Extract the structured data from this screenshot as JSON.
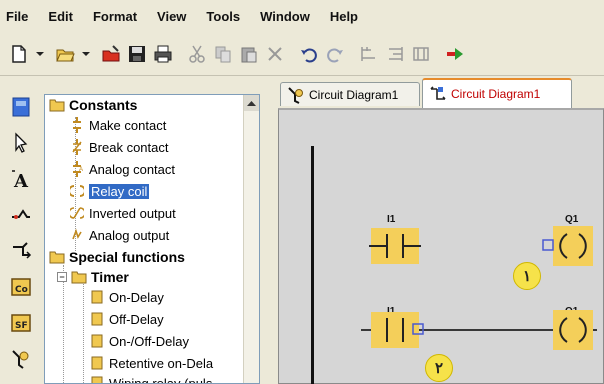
{
  "menu": [
    "File",
    "Edit",
    "Format",
    "View",
    "Tools",
    "Window",
    "Help"
  ],
  "toolbar": {
    "buttons": [
      "new-icon",
      "open-icon",
      "open-recent-icon",
      "save-icon",
      "print-icon",
      "cut-icon",
      "copy-icon",
      "paste-icon",
      "delete-icon",
      "undo-icon",
      "redo-icon",
      "align-icon",
      "align-right-icon",
      "align-group-icon",
      "run-icon"
    ]
  },
  "left_tools": [
    "pointer-icon",
    "text-icon",
    "connect-icon",
    "split-icon",
    "co-block-icon",
    "sf-block-icon",
    "wiring-icon"
  ],
  "tree": {
    "constants_label": "Constants",
    "constants": [
      "Make contact",
      "Break contact",
      "Analog contact",
      "Relay coil",
      "Inverted output",
      "Analog output"
    ],
    "special_label": "Special functions",
    "timer_label": "Timer",
    "timer_items": [
      "On-Delay",
      "Off-Delay",
      "On-/Off-Delay",
      "Retentive on-Dela",
      "Wiping relay (puls"
    ],
    "expander_symbol": "−"
  },
  "tabs": [
    {
      "label": "Circuit Diagram1",
      "active": false
    },
    {
      "label": "Circuit Diagram1",
      "active": true
    }
  ],
  "diagram": {
    "row1_contact": "I1",
    "row1_coil": "Q1",
    "row2_contact": "I1",
    "row2_coil": "Q1",
    "badge1": "١",
    "badge2": "٢",
    "accent": "#f0c030"
  },
  "colors": {
    "selection": "#316ac5",
    "active_tab_text": "#c00000",
    "active_tab_border": "#e68b2c",
    "folder": "#f0c850",
    "badge": "#f6e24a"
  }
}
